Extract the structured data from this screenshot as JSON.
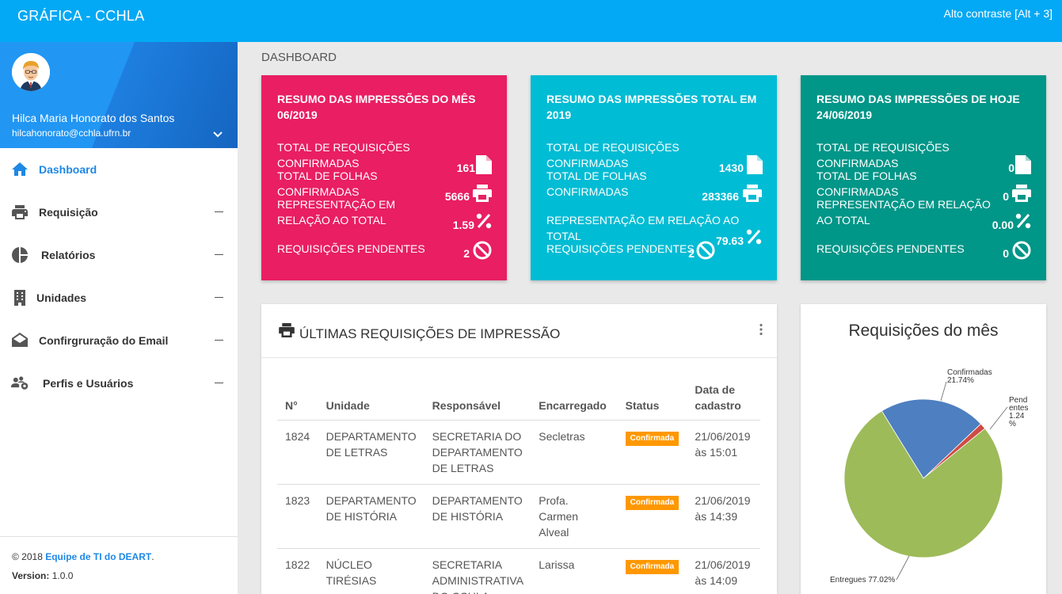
{
  "header": {
    "brand": "GRÁFICA - CCHLA",
    "contrast": "Alto contraste [Alt + 3]"
  },
  "user": {
    "name": "Hilca Maria Honorato dos Santos",
    "email": "hilcahonorato@cchla.ufrn.br"
  },
  "menu": [
    {
      "label": "Dashboard",
      "icon": "home-icon",
      "active": true
    },
    {
      "label": "Requisição",
      "icon": "printer-icon"
    },
    {
      "label": "Relatórios",
      "icon": "pie-chart-icon"
    },
    {
      "label": "Unidades",
      "icon": "building-icon"
    },
    {
      "label": "Confirgruração do Email",
      "icon": "envelope-icon"
    },
    {
      "label": "Perfis e Usuários",
      "icon": "users-gear-icon"
    }
  ],
  "footer": {
    "copyright": "© 2018",
    "team_link": "Equipe de TI do DEART",
    "dot": ".",
    "version_label": "Version:",
    "version": "1.0.0"
  },
  "breadcrumb": "DASHBOARD",
  "cards": {
    "month": {
      "title": "RESUMO DAS IMPRESSÕES DO MÊS 06/2019",
      "req_label": "TOTAL DE REQUISIÇÕES CONFIRMADAS",
      "req_value": "161",
      "sheets_label": "TOTAL DE FOLHAS CONFIRMADAS",
      "sheets_value": "5666",
      "ratio_label": "REPRESENTAÇÃO EM RELAÇÃO AO TOTAL",
      "ratio_value": "1.59",
      "pending_label": "REQUISIÇÕES PENDENTES",
      "pending_value": "2"
    },
    "year": {
      "title": "RESUMO DAS IMPRESSÕES TOTAL EM 2019",
      "req_label": "TOTAL DE REQUISIÇÕES CONFIRMADAS",
      "req_value": "1430",
      "sheets_label": "TOTAL DE FOLHAS CONFIRMADAS",
      "sheets_value": "283366",
      "ratio_label": "REPRESENTAÇÃO EM RELAÇÃO AO TOTAL",
      "ratio_value": "79.63",
      "pending_label": "REQUISIÇÕES PENDENTES",
      "pending_value": "2"
    },
    "today": {
      "title": "RESUMO DAS IMPRESSÕES DE HOJE 24/06/2019",
      "req_label": "TOTAL DE REQUISIÇÕES CONFIRMADAS",
      "req_value": "0",
      "sheets_label": "TOTAL DE FOLHAS CONFIRMADAS",
      "sheets_value": "0",
      "ratio_label": "REPRESENTAÇÃO EM RELAÇÃO AO TOTAL",
      "ratio_value": "0.00",
      "pending_label": "REQUISIÇÕES PENDENTES",
      "pending_value": "0"
    }
  },
  "requests": {
    "title": "ÚLTIMAS REQUISIÇÕES DE IMPRESSÃO",
    "columns": [
      "N°",
      "Unidade",
      "Responsável",
      "Encarregado",
      "Status",
      "Data de cadastro"
    ],
    "rows": [
      {
        "n": "1824",
        "unit": "DEPARTAMENTO DE LETRAS",
        "resp": "SECRETARIA DO DEPARTAMENTO DE LETRAS",
        "enc": "Secletras",
        "status": "Confirmada",
        "date": "21/06/2019 às 15:01"
      },
      {
        "n": "1823",
        "unit": "DEPARTAMENTO DE HISTÓRIA",
        "resp": "DEPARTAMENTO DE HISTÓRIA",
        "enc": "Profa. Carmen Alveal",
        "status": "Confirmada",
        "date": "21/06/2019 às 14:39"
      },
      {
        "n": "1822",
        "unit": "NÚCLEO TIRÉSIAS",
        "resp": "SECRETARIA ADMINISTRATIVA DO CCHLA",
        "enc": "Larissa",
        "status": "Confirmada",
        "date": "21/06/2019 às 14:09"
      }
    ]
  },
  "chart_data": {
    "type": "pie",
    "title": "Requisições do mês",
    "slices": [
      {
        "name": "Confirmadas",
        "label": "Confirmadas 21.74%",
        "value": 21.74,
        "color": "#4e7fc0"
      },
      {
        "name": "Pendentes",
        "label": "Pend entes 1.24 %",
        "value": 1.24,
        "color": "#cf4b44"
      },
      {
        "name": "Entregues",
        "label": "Entregues 77.02%",
        "value": 77.02,
        "color": "#9dbb59"
      }
    ]
  }
}
